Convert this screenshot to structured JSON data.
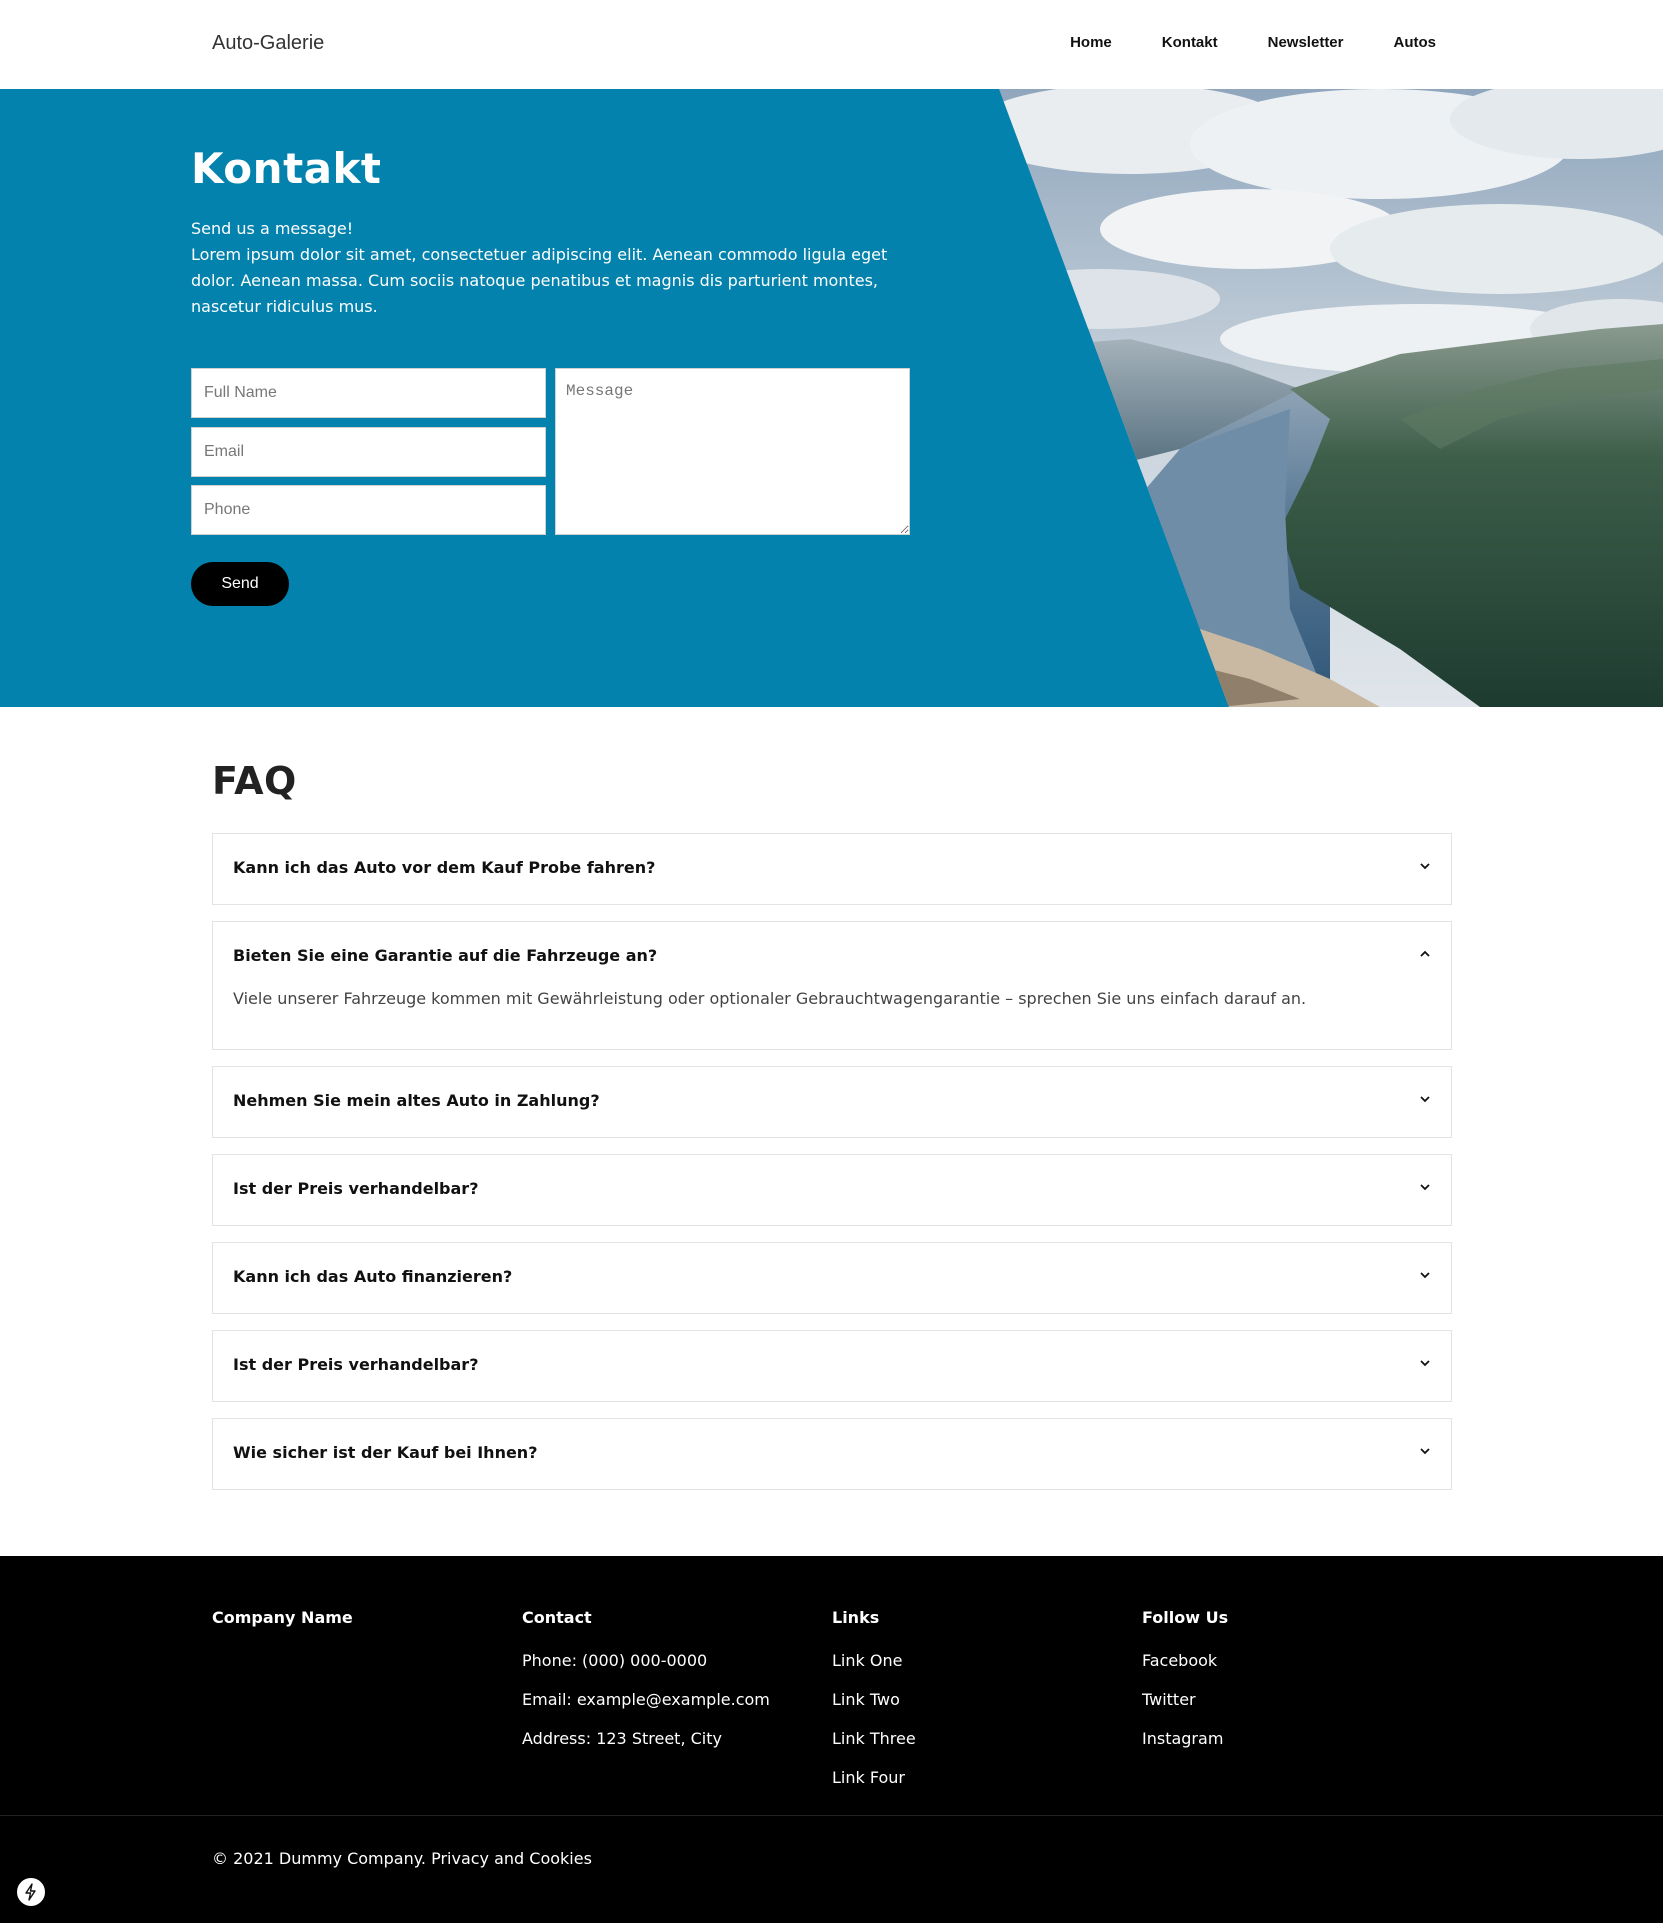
{
  "header": {
    "logo": "Auto-Galerie",
    "nav": [
      "Home",
      "Kontakt",
      "Newsletter",
      "Autos"
    ]
  },
  "hero": {
    "title": "Kontakt",
    "intro": "Send us a message!",
    "body": "Lorem ipsum dolor sit amet, consectetuer adipiscing elit. Aenean commodo ligula eget dolor. Aenean massa. Cum sociis natoque penatibus et magnis dis parturient montes, nascetur ridiculus mus.",
    "background_color": "#0282ad",
    "image": "fjord-landscape-photo"
  },
  "form": {
    "name_placeholder": "Full Name",
    "email_placeholder": "Email",
    "phone_placeholder": "Phone",
    "message_placeholder": "Message",
    "send_label": "Send"
  },
  "faq": {
    "title": "FAQ",
    "items": [
      {
        "question": "Kann ich das Auto vor dem Kauf Probe fahren?",
        "expanded": false,
        "answer": ""
      },
      {
        "question": "Bieten Sie eine Garantie auf die Fahrzeuge an?",
        "expanded": true,
        "answer": "Viele unserer Fahrzeuge kommen mit Gewährleistung oder optionaler Gebrauchtwagengarantie – sprechen Sie uns einfach darauf an."
      },
      {
        "question": "Nehmen Sie mein altes Auto in Zahlung?",
        "expanded": false,
        "answer": ""
      },
      {
        "question": "Ist der Preis verhandelbar?",
        "expanded": false,
        "answer": ""
      },
      {
        "question": "Kann ich das Auto finanzieren?",
        "expanded": false,
        "answer": ""
      },
      {
        "question": "Ist der Preis verhandelbar?",
        "expanded": false,
        "answer": ""
      },
      {
        "question": "Wie sicher ist der Kauf bei Ihnen?",
        "expanded": false,
        "answer": ""
      }
    ]
  },
  "footer": {
    "company": {
      "title": "Company Name"
    },
    "contact": {
      "title": "Contact",
      "lines": [
        "Phone: (000) 000-0000",
        "Email: example@example.com",
        "Address: 123 Street, City"
      ]
    },
    "links": {
      "title": "Links",
      "lines": [
        "Link One",
        "Link Two",
        "Link Three",
        "Link Four"
      ]
    },
    "follow": {
      "title": "Follow Us",
      "lines": [
        "Facebook",
        "Twitter",
        "Instagram"
      ]
    },
    "copyright": "© 2021 Dummy Company. Privacy and Cookies"
  }
}
